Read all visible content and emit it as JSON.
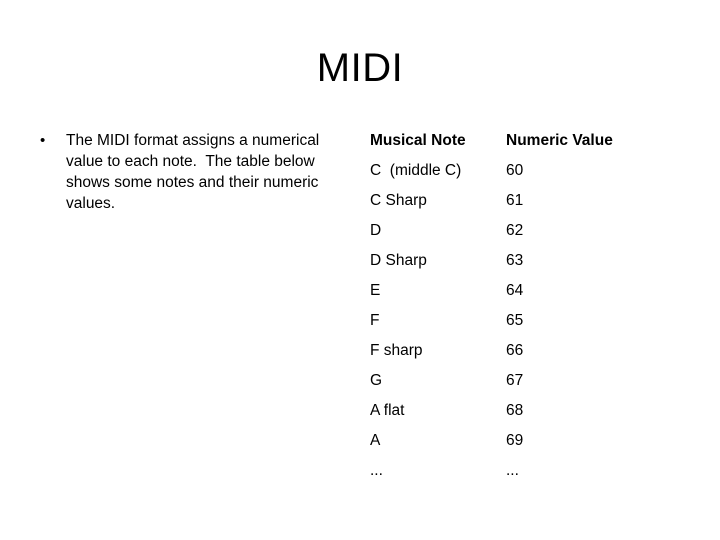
{
  "slide": {
    "title": "MIDI",
    "background_color": "#ffffff",
    "text_color": "#000000"
  },
  "bullets": [
    {
      "marker": "•",
      "text": "The MIDI format assigns a numerical value to each note.  The table below shows some notes and their numeric values."
    }
  ],
  "table": {
    "headers": {
      "note": "Musical Note",
      "value": "Numeric Value"
    },
    "rows": [
      {
        "note": "C  (middle C)",
        "value": "60"
      },
      {
        "note": "C Sharp",
        "value": "61"
      },
      {
        "note": "D",
        "value": "62"
      },
      {
        "note": "D Sharp",
        "value": "63"
      },
      {
        "note": "E",
        "value": "64"
      },
      {
        "note": "F",
        "value": "65"
      },
      {
        "note": "F sharp",
        "value": "66"
      },
      {
        "note": "G",
        "value": "67"
      },
      {
        "note": "A flat",
        "value": "68"
      },
      {
        "note": "A",
        "value": "69"
      },
      {
        "note": "...",
        "value": "..."
      }
    ]
  }
}
